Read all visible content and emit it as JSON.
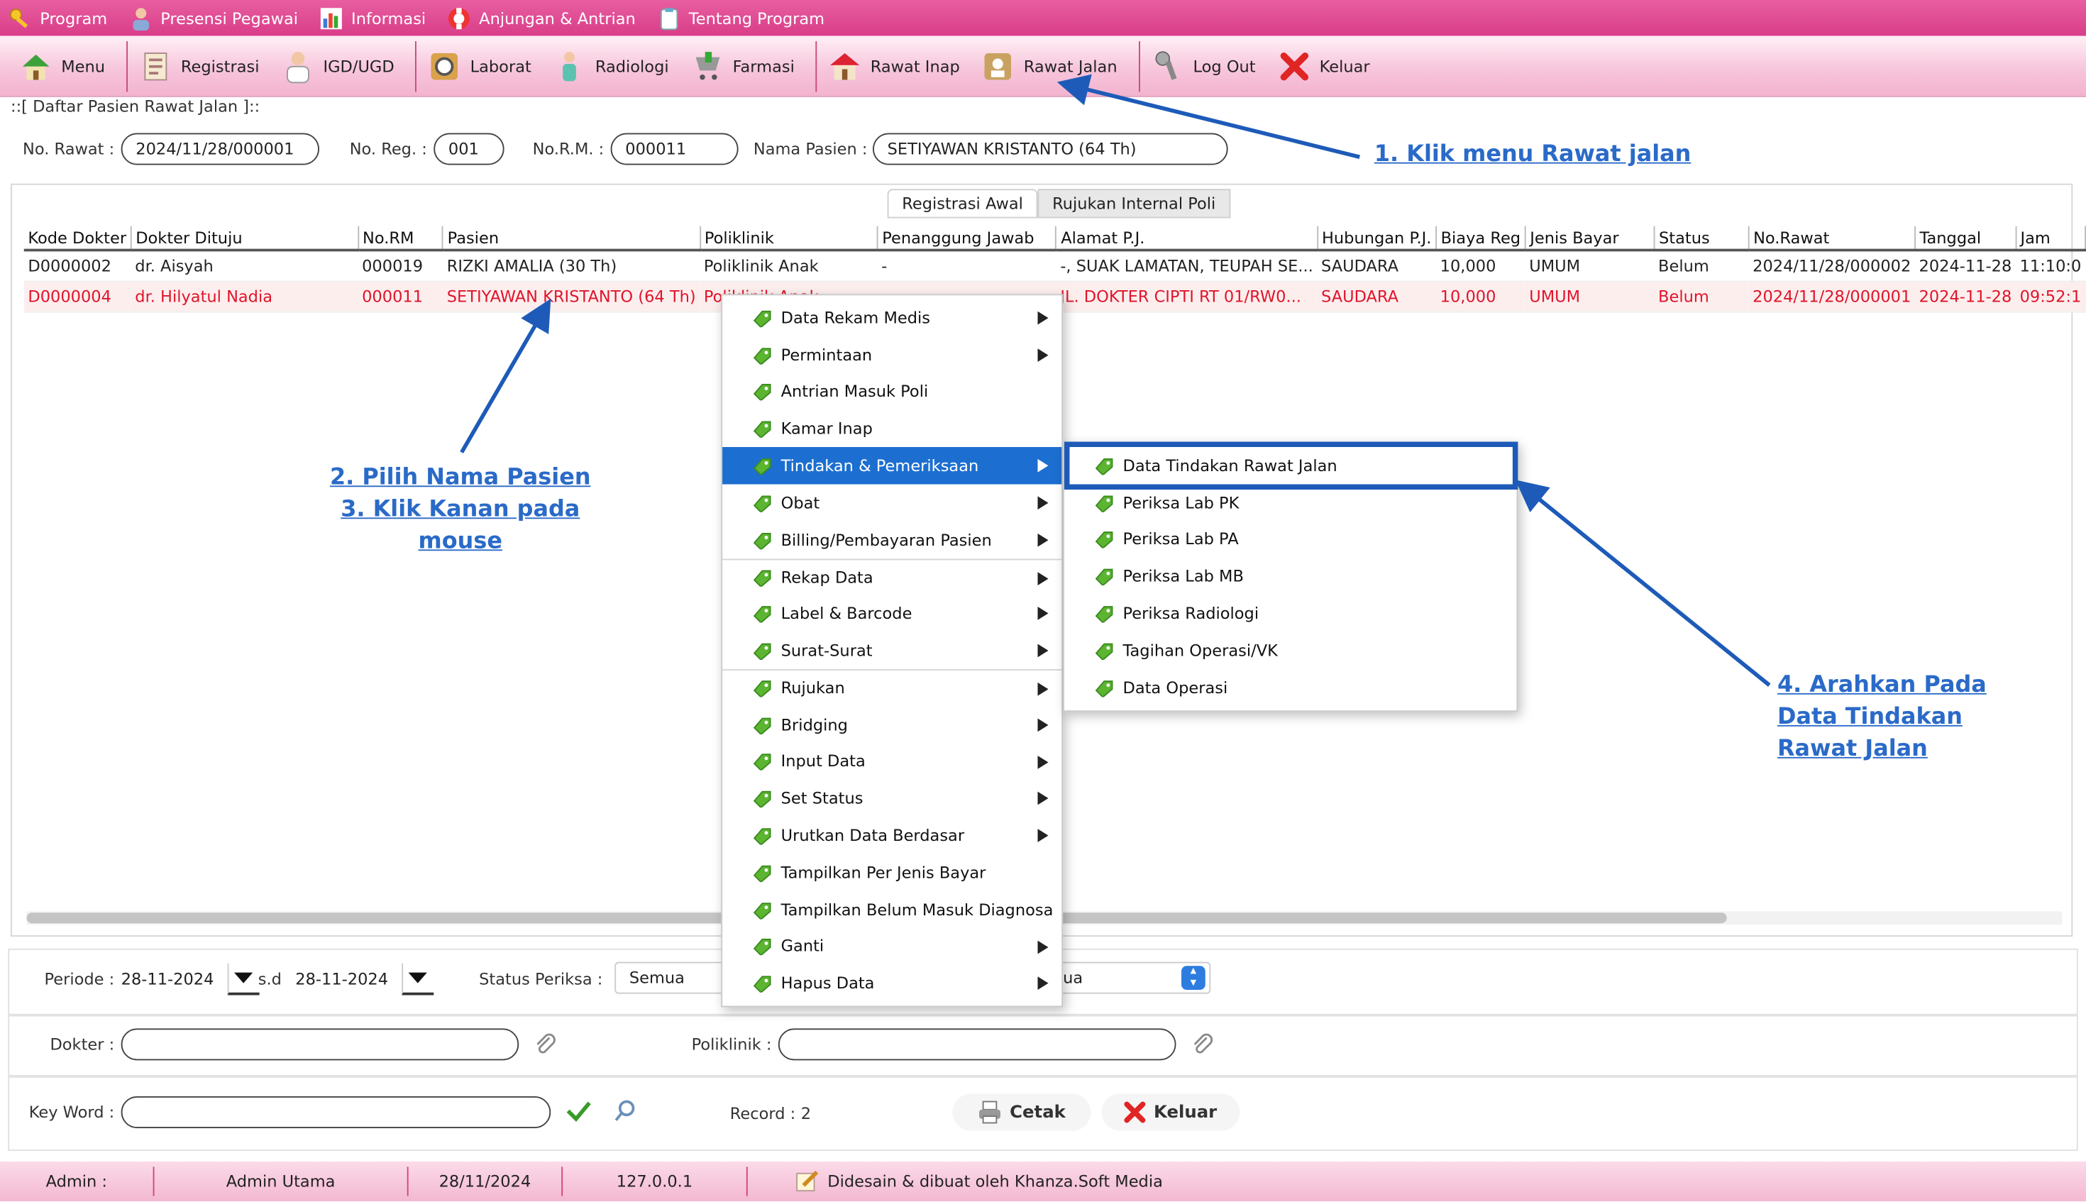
{
  "menubar": {
    "items": [
      {
        "label": "Program",
        "icon": "key-icon"
      },
      {
        "label": "Presensi Pegawai",
        "icon": "employee-icon"
      },
      {
        "label": "Informasi",
        "icon": "info-chart-icon"
      },
      {
        "label": "Anjungan & Antrian",
        "icon": "lifebuoy-icon"
      },
      {
        "label": "Tentang Program",
        "icon": "clipboard-icon"
      }
    ]
  },
  "toolbar": {
    "items": [
      {
        "label": "Menu",
        "icon": "home-icon"
      },
      {
        "label": "Registrasi",
        "icon": "registration-icon"
      },
      {
        "label": "IGD/UGD",
        "icon": "doctor-icon"
      },
      {
        "label": "Laborat",
        "icon": "laboratory-icon"
      },
      {
        "label": "Radiologi",
        "icon": "radiology-icon"
      },
      {
        "label": "Farmasi",
        "icon": "pharmacy-icon"
      },
      {
        "label": "Rawat Inap",
        "icon": "hospital-icon"
      },
      {
        "label": "Rawat Jalan",
        "icon": "outpatient-icon"
      },
      {
        "label": "Log Out",
        "icon": "logout-icon"
      },
      {
        "label": "Keluar",
        "icon": "exit-icon"
      }
    ]
  },
  "section_title": "::[ Daftar Pasien Rawat Jalan ]::",
  "form": {
    "no_rawat_label": "No. Rawat :",
    "no_rawat": "2024/11/28/000001",
    "no_reg_label": "No. Reg. :",
    "no_reg": "001",
    "no_rm_label": "No.R.M. :",
    "no_rm": "000011",
    "nama_label": "Nama Pasien :",
    "nama": "SETIYAWAN KRISTANTO (64 Th)"
  },
  "tabs": [
    "Registrasi Awal",
    "Rujukan Internal Poli"
  ],
  "table": {
    "headers": [
      "Kode Dokter",
      "Dokter Dituju",
      "No.RM",
      "Pasien",
      "Poliklinik",
      "Penanggung Jawab",
      "Alamat P.J.",
      "Hubungan P.J.",
      "Biaya Reg",
      "Jenis Bayar",
      "Status",
      "No.Rawat",
      "Tanggal",
      "Jam"
    ],
    "rows": [
      [
        "D0000002",
        "dr. Aisyah",
        "000019",
        "RIZKI AMALIA (30 Th)",
        "Poliklinik Anak",
        "-",
        "-, SUAK LAMATAN, TEUPAH SE...",
        "SAUDARA",
        "10,000",
        "UMUM",
        "Belum",
        "2024/11/28/000002",
        "2024-11-28",
        "11:10:0"
      ],
      [
        "D0000004",
        "dr. Hilyatul Nadia",
        "000011",
        "SETIYAWAN KRISTANTO (64 Th)",
        "Poliklinik Anak",
        "-",
        "JL. DOKTER CIPTI RT 01/RW0...",
        "SAUDARA",
        "10,000",
        "UMUM",
        "Belum",
        "2024/11/28/000001",
        "2024-11-28",
        "09:52:1"
      ]
    ]
  },
  "context_menu": {
    "items": [
      "Data Rekam Medis",
      "Permintaan",
      "Antrian Masuk Poli",
      "Kamar Inap",
      "Tindakan & Pemeriksaan",
      "Obat",
      "Billing/Pembayaran Pasien",
      "Rekap Data",
      "Label & Barcode",
      "Surat-Surat",
      "Rujukan",
      "Bridging",
      "Input Data",
      "Set Status",
      "Urutkan Data Berdasar",
      "Tampilkan Per Jenis Bayar",
      "Tampilkan Belum Masuk Diagnosa",
      "Ganti",
      "Hapus Data"
    ],
    "highlighted": "Tindakan & Pemeriksaan"
  },
  "submenu": {
    "items": [
      "Data Tindakan Rawat Jalan",
      "Periksa Lab PK",
      "Periksa Lab PA",
      "Periksa Lab MB",
      "Periksa Radiologi",
      "Tagihan Operasi/VK",
      "Data Operasi"
    ]
  },
  "filters": {
    "periode_label": "Periode :",
    "date_from": "28-11-2024",
    "sd_label": "s.d",
    "date_to": "28-11-2024",
    "status_label": "Status Periksa :",
    "status_value": "Semua",
    "bayar_value": "ua",
    "dokter_label": "Dokter :",
    "poli_label": "Poliklinik :",
    "keyword_label": "Key Word :",
    "record_label": "Record :",
    "record_count": "2",
    "cetak": "Cetak",
    "keluar": "Keluar"
  },
  "statusbar": {
    "admin_label": "Admin :",
    "admin_name": "Admin Utama",
    "date": "28/11/2024",
    "ip": "127.0.0.1",
    "credit": "Didesain & dibuat oleh Khanza.Soft Media"
  },
  "annotations": {
    "step1": "1. Klik menu Rawat jalan",
    "step2": "2. Pilih Nama Pasien",
    "step3": "3. Klik Kanan pada mouse",
    "step4a": "4. Arahkan Pada",
    "step4b": "Data Tindakan",
    "step4c": "Rawat Jalan"
  },
  "colors": {
    "menubar": "#e04f94",
    "selected_row_text": "#e0142a",
    "menu_highlight": "#1c6fd0",
    "annotation": "#2a6ac8",
    "leaf_green": "#5cb531"
  }
}
